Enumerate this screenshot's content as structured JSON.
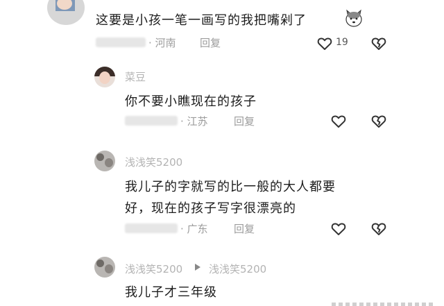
{
  "comments": [
    {
      "text": "这要是小孩一笔一画写的我把嘴剁了",
      "emoji": "dog-face-emoji",
      "location": "河南",
      "reply_label": "回复",
      "like_count": "19"
    },
    {
      "name": "菜豆",
      "text": "你不要小瞧现在的孩子",
      "location": "江苏",
      "reply_label": "回复"
    },
    {
      "name": "浅浅笑5200",
      "text_line1": "我儿子的字就写的比一般的大人都要",
      "text_line2": "好，现在的孩子写字很漂亮的",
      "location": "广东",
      "reply_label": "回复"
    },
    {
      "name": "浅浅笑5200",
      "reply_to": "浅浅笑5200",
      "text": "我儿子才三年级"
    }
  ],
  "icons": {
    "like": "heart-outline-icon",
    "dislike": "broken-heart-icon",
    "reply_arrow": "triangle-right-icon"
  }
}
